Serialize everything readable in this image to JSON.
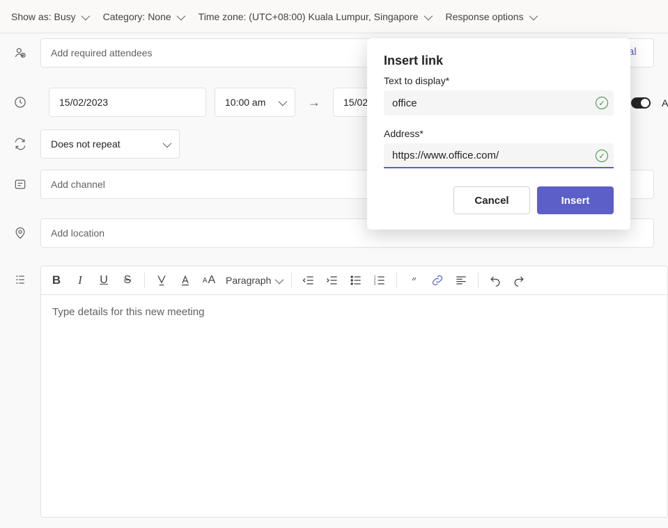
{
  "options": {
    "show_as": "Show as: Busy",
    "category": "Category: None",
    "timezone": "Time zone: (UTC+08:00) Kuala Lumpur, Singapore",
    "response": "Response options"
  },
  "attendees": {
    "placeholder": "Add required attendees"
  },
  "date": {
    "start_date": "15/02/2023",
    "start_time": "10:00 am",
    "end_date_partial": "15/02/"
  },
  "recurrence": {
    "label": "Does not repeat"
  },
  "channel": {
    "placeholder": "Add channel"
  },
  "location": {
    "placeholder": "Add location"
  },
  "editor": {
    "paragraph_label": "Paragraph",
    "placeholder": "Type details for this new meeting"
  },
  "popover": {
    "title": "Insert link",
    "text_label": "Text to display*",
    "text_value": "office",
    "address_label": "Address*",
    "address_value": "https://www.office.com/",
    "cancel": "Cancel",
    "insert": "Insert"
  },
  "edge": {
    "al": "al",
    "letter": "A"
  },
  "colors": {
    "accent": "#5b5fc7"
  }
}
